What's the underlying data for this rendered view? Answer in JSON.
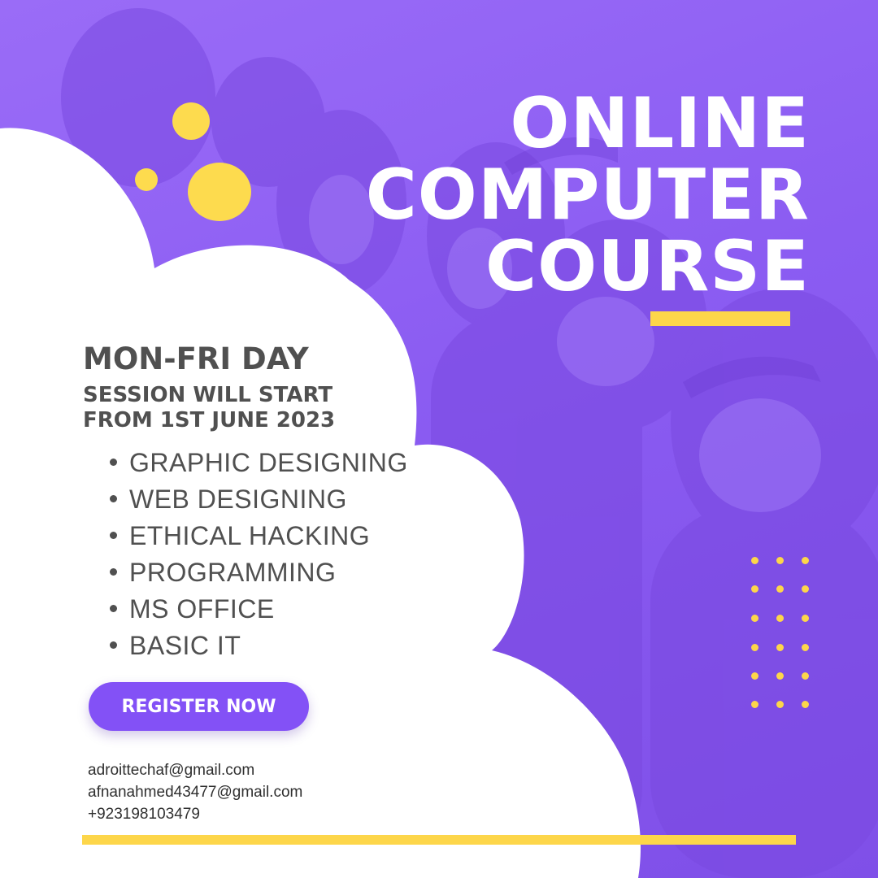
{
  "title_lines": [
    "ONLINE",
    "COMPUTER",
    "COURSE"
  ],
  "schedule": {
    "days": "MON-FRI DAY",
    "session_note": "SESSION WILL START FROM 1ST JUNE 2023"
  },
  "courses": [
    "GRAPHIC DESIGNING",
    "WEB DESIGNING",
    "ETHICAL HACKING",
    "PROGRAMMING",
    "MS OFFICE",
    "BASIC IT"
  ],
  "register_label": "REGISTER NOW",
  "contacts": [
    "adroittechaf@gmail.com",
    "afnanahmed43477@gmail.com",
    "+923198103479"
  ],
  "colors": {
    "purple_background": "#8b5cf2",
    "accent_yellow": "#fdd64a",
    "button_purple": "#8351f6",
    "text_gray": "#505050",
    "panel_white": "#ffffff"
  }
}
